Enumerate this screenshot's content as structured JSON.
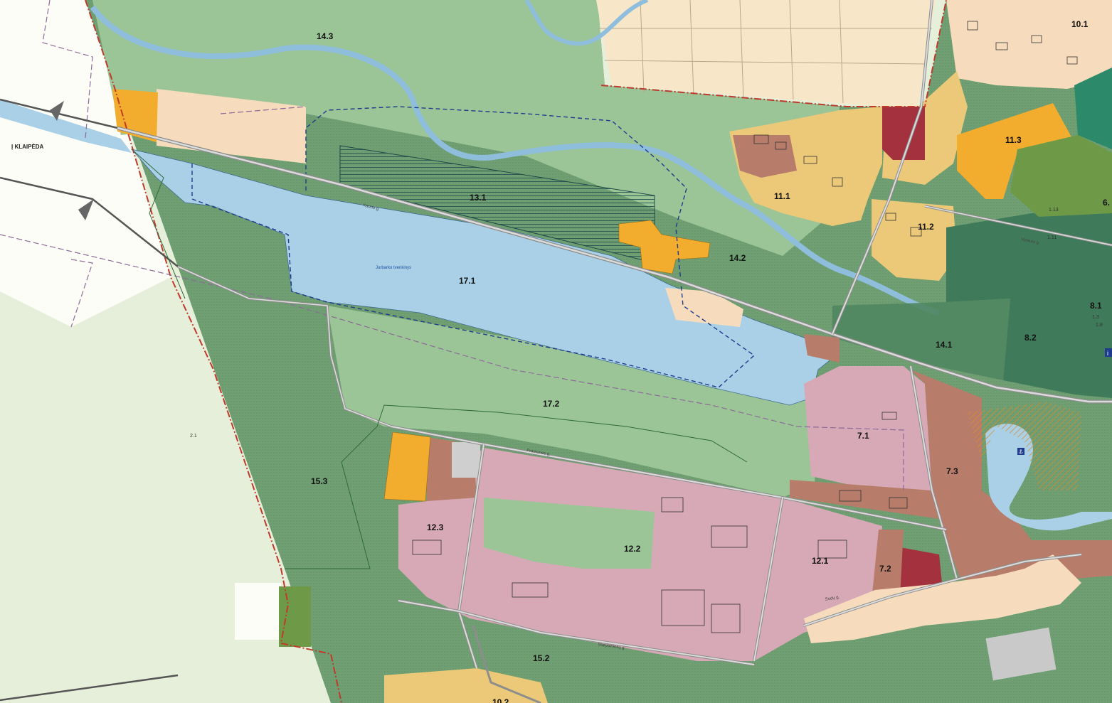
{
  "map": {
    "direction_label": "Į KLAIPĖDA",
    "water_body_name": "Jurbarko tvenkinys",
    "zones": [
      {
        "id": "14.3",
        "label": "14.3"
      },
      {
        "id": "13.1",
        "label": "13.1"
      },
      {
        "id": "17.1",
        "label": "17.1"
      },
      {
        "id": "14.2",
        "label": "14.2"
      },
      {
        "id": "11.1",
        "label": "11.1"
      },
      {
        "id": "11.2",
        "label": "11.2"
      },
      {
        "id": "11.3",
        "label": "11.3"
      },
      {
        "id": "10.1",
        "label": "10.1"
      },
      {
        "id": "14.1",
        "label": "14.1"
      },
      {
        "id": "8.1",
        "label": "8.1"
      },
      {
        "id": "8.2",
        "label": "8.2"
      },
      {
        "id": "17.2",
        "label": "17.2"
      },
      {
        "id": "7.1",
        "label": "7.1"
      },
      {
        "id": "7.3",
        "label": "7.3"
      },
      {
        "id": "7.2",
        "label": "7.2"
      },
      {
        "id": "15.3",
        "label": "15.3"
      },
      {
        "id": "12.3",
        "label": "12.3"
      },
      {
        "id": "12.2",
        "label": "12.2"
      },
      {
        "id": "12.1",
        "label": "12.1"
      },
      {
        "id": "15.2",
        "label": "15.2"
      },
      {
        "id": "2.1",
        "label": "2.1"
      },
      {
        "id": "6",
        "label": "6."
      },
      {
        "id": "10.2",
        "label": "10.2"
      }
    ],
    "minor_labels": [
      "1.13",
      "1.11",
      "1.3",
      "1.8"
    ],
    "street_labels": [
      "Kauno g.",
      "Pramonės g.",
      "Statybininkų g.",
      "Vytauto g.",
      "Sodų g."
    ],
    "colors": {
      "water": "#a9d0e6",
      "green_zone": "#9cc597",
      "forest_zone": "#76a878",
      "dark_forest": "#3f7b5a",
      "industrial": "#d7a8b6",
      "residential": "#ecc978",
      "commercial": "#f3ad2e",
      "mixed": "#b87d6a",
      "public": "#a3313e",
      "agricultural": "#f7e7c8",
      "outside": "#e6efd9",
      "boundary": "#c0392b"
    }
  }
}
